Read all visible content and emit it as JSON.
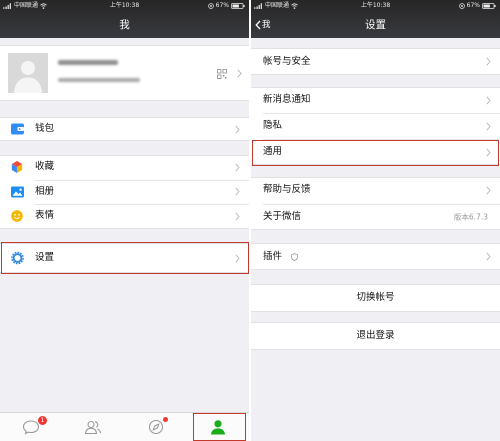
{
  "colors": {
    "nav_bg": "#393a3f",
    "page_bg": "#efeff4",
    "highlight": "#c23a2b",
    "wechat_green": "#1aad19",
    "badge_red": "#f43530"
  },
  "me": {
    "status": {
      "carrier": "中国联通",
      "time": "上午10:38",
      "battery": "67%"
    },
    "title": "我",
    "profile": {
      "avatar_icon": "avatar-placeholder-icon",
      "qr_icon": "qr-code-icon"
    },
    "wallet": {
      "label": "钱包",
      "icon": "wallet-icon"
    },
    "favorites": {
      "label": "收藏",
      "icon": "favorites-cube-icon"
    },
    "album": {
      "label": "相册",
      "icon": "album-icon"
    },
    "stickers": {
      "label": "表情",
      "icon": "sticker-smiley-icon"
    },
    "settings": {
      "label": "设置",
      "icon": "gear-icon"
    },
    "tabbar": {
      "chats_badge": "1",
      "tabs": [
        {
          "icon": "chat-bubble-icon"
        },
        {
          "icon": "contacts-icon"
        },
        {
          "icon": "compass-icon"
        },
        {
          "icon": "me-person-icon",
          "active": true
        }
      ]
    }
  },
  "settings": {
    "status": {
      "carrier": "中国联通",
      "time": "上午10:38",
      "battery": "67%"
    },
    "back_label": "我",
    "title": "设置",
    "account_security": "帐号与安全",
    "new_message_notify": "新消息通知",
    "privacy": "隐私",
    "general": "通用",
    "help_feedback": "帮助与反馈",
    "about": "关于微信",
    "version": "版本6.7.3",
    "plugins": "插件",
    "plugins_icon": "shield-icon",
    "switch_account": "切换帐号",
    "logout": "退出登录"
  }
}
